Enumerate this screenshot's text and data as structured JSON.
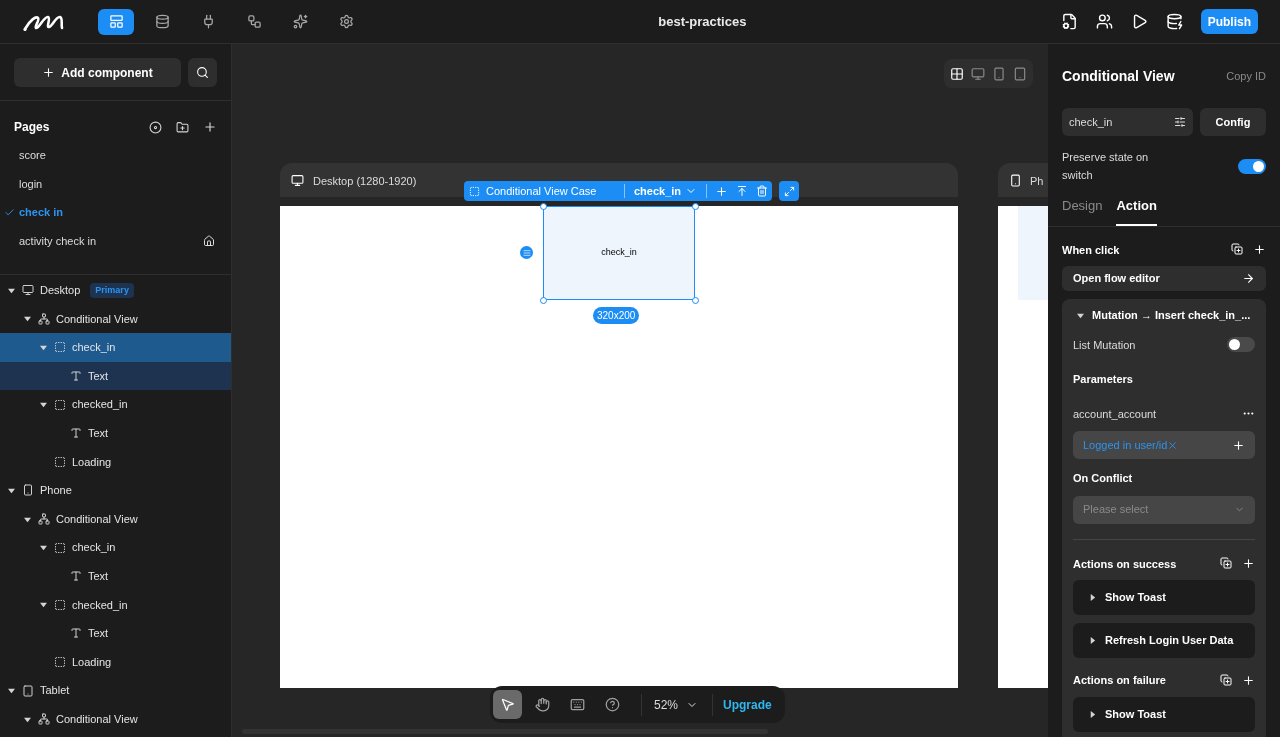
{
  "topbar": {
    "nav": [
      {
        "kind": "pages",
        "selected": true
      },
      {
        "kind": "data",
        "selected": false
      },
      {
        "kind": "api",
        "selected": false
      },
      {
        "kind": "flow",
        "selected": false
      },
      {
        "kind": "ai",
        "selected": false
      },
      {
        "kind": "settings",
        "selected": false
      }
    ],
    "title": "best-practices",
    "actions": [
      {
        "kind": "file-settings"
      },
      {
        "kind": "users"
      },
      {
        "kind": "play"
      },
      {
        "kind": "database-check"
      }
    ],
    "publish": "Publish"
  },
  "sidebar": {
    "add_component": "Add component",
    "pages_title": "Pages",
    "pages": [
      {
        "label": "score",
        "selected": false,
        "home": false
      },
      {
        "label": "login",
        "selected": false,
        "home": false
      },
      {
        "label": "check in",
        "selected": true,
        "home": false
      },
      {
        "label": "activity check in",
        "selected": false,
        "home": true
      }
    ],
    "tree": [
      {
        "kind": "desktop",
        "label": "Desktop",
        "badge": "Primary",
        "expanded": true,
        "selected": false,
        "children": [
          {
            "kind": "conditional",
            "label": "Conditional View",
            "expanded": true,
            "selected": false,
            "children": [
              {
                "kind": "container",
                "label": "check_in",
                "expanded": true,
                "selected": true,
                "children": [
                  {
                    "kind": "text",
                    "label": "Text",
                    "selected": false
                  }
                ]
              },
              {
                "kind": "container",
                "label": "checked_in",
                "expanded": true,
                "selected": false,
                "children": [
                  {
                    "kind": "text",
                    "label": "Text",
                    "selected": false
                  }
                ]
              },
              {
                "kind": "container",
                "label": "Loading",
                "selected": false
              }
            ]
          }
        ]
      },
      {
        "kind": "phone",
        "label": "Phone",
        "expanded": true,
        "selected": false,
        "children": [
          {
            "kind": "conditional",
            "label": "Conditional View",
            "expanded": true,
            "selected": false,
            "children": [
              {
                "kind": "container",
                "label": "check_in",
                "expanded": true,
                "selected": false,
                "children": [
                  {
                    "kind": "text",
                    "label": "Text",
                    "selected": false
                  }
                ]
              },
              {
                "kind": "container",
                "label": "checked_in",
                "expanded": true,
                "selected": false,
                "children": [
                  {
                    "kind": "text",
                    "label": "Text",
                    "selected": false
                  }
                ]
              },
              {
                "kind": "container",
                "label": "Loading",
                "selected": false
              }
            ]
          }
        ]
      },
      {
        "kind": "tablet",
        "label": "Tablet",
        "expanded": true,
        "selected": false,
        "children": [
          {
            "kind": "conditional",
            "label": "Conditional View",
            "expanded": true,
            "selected": false
          }
        ]
      }
    ]
  },
  "canvas": {
    "devices": [
      {
        "kind": "all",
        "selected": false
      },
      {
        "kind": "desktop",
        "selected": false
      },
      {
        "kind": "phone",
        "selected": false
      },
      {
        "kind": "tablet",
        "selected": false
      }
    ],
    "desktop_frame": "Desktop (1280-1920)",
    "phone_frame": "Ph",
    "selection_type": "Conditional View Case",
    "selection_case": "check_in",
    "element_text": "check_in",
    "element_size": "320x200",
    "tools": [
      {
        "kind": "pointer",
        "selected": true
      },
      {
        "kind": "hand",
        "selected": false
      },
      {
        "kind": "keyboard",
        "selected": false
      },
      {
        "kind": "help",
        "selected": false
      }
    ],
    "zoom": "52%",
    "upgrade": "Upgrade"
  },
  "inspector": {
    "title": "Conditional View",
    "copy_id": "Copy ID",
    "state_value": "check_in",
    "config": "Config",
    "preserve_label": "Preserve state on switch",
    "preserve_on": true,
    "tabs": [
      {
        "label": "Design",
        "selected": false
      },
      {
        "label": "Action",
        "selected": true
      }
    ],
    "when_click": "When click",
    "open_flow": "Open flow editor",
    "mutation": {
      "title": "Mutation → Insert check_in_...",
      "expanded": true,
      "list_mutation_label": "List Mutation",
      "list_mutation_on": false,
      "parameters": "Parameters",
      "param_name": "account_account",
      "param_value": "Logged in user/id",
      "on_conflict": "On Conflict",
      "conflict_placeholder": "Please select"
    },
    "success_title": "Actions on success",
    "success_actions": [
      "Show Toast",
      "Refresh Login User Data"
    ],
    "failure_title": "Actions on failure",
    "failure_actions": [
      "Show Toast"
    ]
  }
}
